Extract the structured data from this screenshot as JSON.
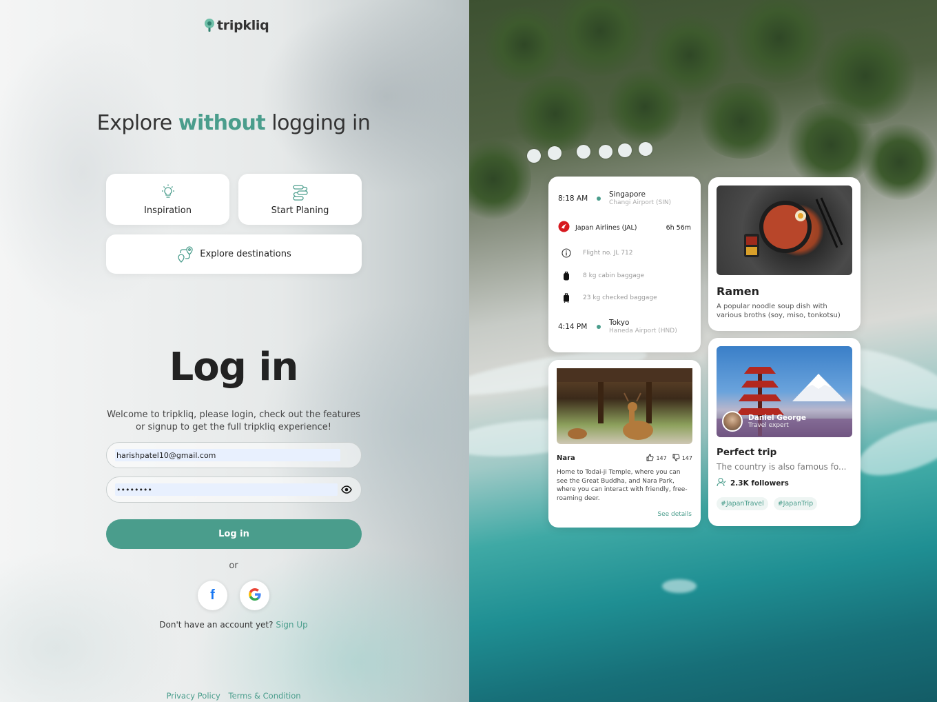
{
  "brand": {
    "name": "tripkliq",
    "accent": "#4a9d8c"
  },
  "explore": {
    "title_pre": "Explore ",
    "title_highlight": "without",
    "title_post": " logging in",
    "buttons": [
      {
        "label": "Inspiration",
        "icon": "lightbulb-icon"
      },
      {
        "label": "Start Planing",
        "icon": "route-plan-icon"
      },
      {
        "label": "Explore destinations",
        "icon": "map-route-icon"
      }
    ]
  },
  "login": {
    "title": "Log in",
    "welcome": "Welcome to tripkliq, please login, check out the features or signup to get the full tripkliq experience!",
    "email_value": "harishpatel10@gmail.com",
    "password_value": "••••••••",
    "submit_label": "Log in",
    "or_text": "or",
    "signup_prompt": "Don't have an account yet?",
    "signup_link": "Sign Up"
  },
  "footer": {
    "privacy": "Privacy Policy",
    "terms": "Terms & Condition"
  },
  "flight": {
    "depart_time": "8:18 AM",
    "depart_city": "Singapore",
    "depart_airport": "Changi Airport (SIN)",
    "airline": "Japan Airlines (JAL)",
    "duration": "6h 56m",
    "flight_no": "Flight no. JL 712",
    "cabin_baggage": "8 kg cabin baggage",
    "checked_baggage": "23 kg checked baggage",
    "arrive_time": "4:14 PM",
    "arrive_city": "Tokyo",
    "arrive_airport": "Haneda Airport (HND)"
  },
  "ramen": {
    "title": "Ramen",
    "desc": "A popular noodle soup dish with various broths (soy, miso, tonkotsu)"
  },
  "nara": {
    "name": "Nara",
    "likes": "147",
    "dislikes": "147",
    "desc": "Home to Todai-ji Temple, where you can see the Great Buddha, and Nara Park, where you can interact with friendly, free-roaming deer.",
    "see_details": "See details"
  },
  "trip": {
    "author": "Daniel George",
    "role": "Travel expert",
    "title": "Perfect trip",
    "desc": "The country is also famous fo...",
    "followers": "2.3K followers",
    "tags": [
      "#JapanTravel",
      "#JapanTrip"
    ]
  }
}
